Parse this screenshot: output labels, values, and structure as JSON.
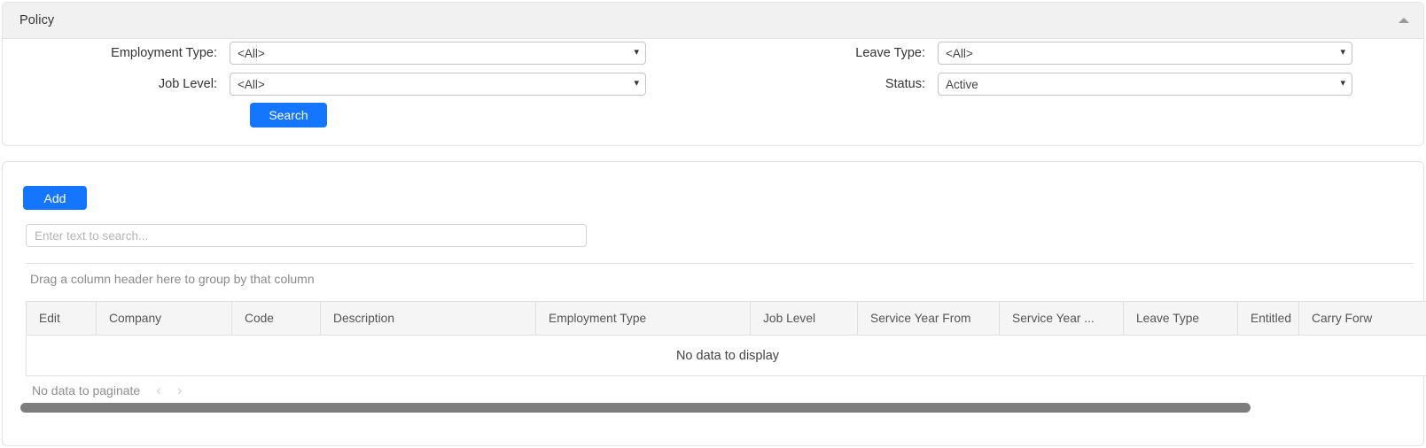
{
  "filter_panel": {
    "title": "Policy",
    "collapse_icon": "chevron-up-icon",
    "fields": [
      {
        "label": "Employment Type:",
        "value": "<All>",
        "icon": "chevron-down-icon"
      },
      {
        "label": "Job Level:",
        "value": "<All>",
        "icon": "chevron-down-icon"
      },
      {
        "label": "Leave Type:",
        "value": "<All>",
        "icon": "chevron-down-icon"
      },
      {
        "label": "Status:",
        "value": "Active",
        "icon": "chevron-down-icon"
      }
    ],
    "search_button": "Search"
  },
  "grid_panel": {
    "add_button": "Add",
    "search_placeholder": "Enter text to search...",
    "search_value": "",
    "group_hint": "Drag a column header here to group by that column",
    "columns": [
      "Edit",
      "Company",
      "Code",
      "Description",
      "Employment Type",
      "Job Level",
      "Service Year From",
      "Service Year ...",
      "Leave Type",
      "Entitled",
      "Carry Forw"
    ],
    "empty_message": "No data to display",
    "pager": {
      "text": "No data to paginate",
      "prev_icon": "chevron-left-icon",
      "prev_glyph": "‹",
      "next_icon": "chevron-right-icon",
      "next_glyph": "›"
    }
  },
  "colors": {
    "accent": "#1476ff",
    "panel_header": "#f1f1f1",
    "grid_header": "#f5f5f5",
    "scrollbar_thumb": "#7d7d7d",
    "border": "#e0e0e0"
  }
}
